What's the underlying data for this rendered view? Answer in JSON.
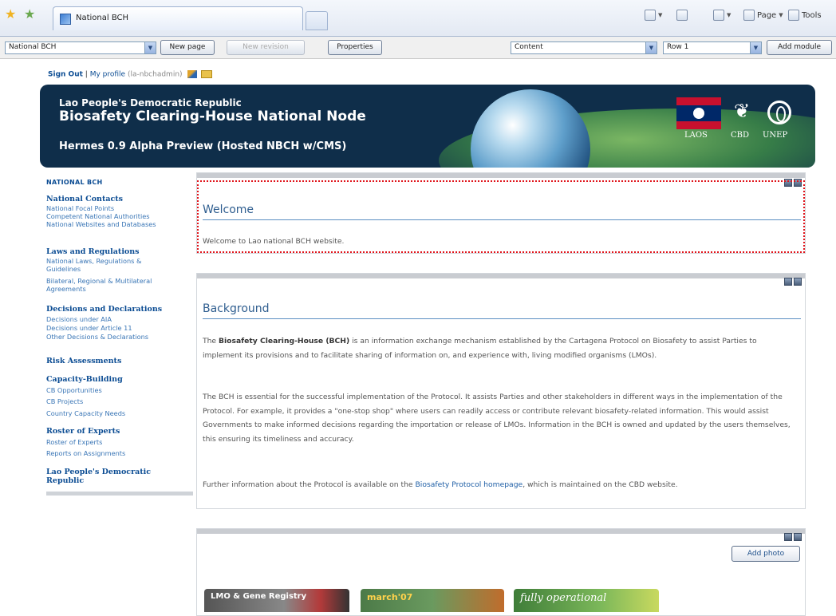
{
  "browser": {
    "tab_title": "National BCH",
    "page_menu": "Page",
    "tools_menu": "Tools"
  },
  "cms_toolbar": {
    "page_select": "National BCH",
    "new_page": "New page",
    "new_revision": "New revision",
    "properties": "Properties",
    "region_select": "Content",
    "row_select": "Row 1",
    "add_module": "Add module"
  },
  "user": {
    "sign_out": "Sign Out",
    "separator": "|",
    "my_profile": "My profile",
    "username": "(la-nbchadmin)"
  },
  "banner": {
    "line1": "Lao People's Democratic Republic",
    "line2": "Biosafety Clearing-House National Node",
    "line3": "Hermes 0.9 Alpha Preview (Hosted NBCH w/CMS)",
    "logo_laos": "LAOS",
    "logo_cbd": "CBD",
    "logo_unep": "UNEP"
  },
  "sidebar": {
    "title": "NATIONAL BCH",
    "sections": [
      {
        "heading": "National Contacts",
        "links": [
          "National Focal Points",
          "Competent National Authorities",
          "National Websites and Databases"
        ]
      },
      {
        "heading": "Laws and Regulations",
        "links": [
          "National Laws, Regulations & Guidelines",
          "Bilateral, Regional & Multilateral Agreements"
        ]
      },
      {
        "heading": "Decisions and Declarations",
        "links": [
          "Decisions under AIA",
          "Decisions under Article 11",
          "Other Decisions & Declarations"
        ]
      },
      {
        "heading": "Risk Assessments",
        "links": []
      },
      {
        "heading": "Capacity-Building",
        "links": [
          "CB Opportunities",
          "CB Projects",
          "Country Capacity Needs"
        ]
      },
      {
        "heading": "Roster of Experts",
        "links": [
          "Roster of Experts",
          "Reports on Assignments"
        ]
      },
      {
        "heading": "Lao People's Democratic Republic",
        "links": []
      }
    ]
  },
  "welcome": {
    "title": "Welcome",
    "text": "Welcome to Lao national BCH website."
  },
  "background": {
    "title": "Background",
    "p1_strong": "Biosafety Clearing-House (BCH)",
    "p1_pre": "The ",
    "p1_post": " is an information exchange mechanism established by the Cartagena Protocol on Biosafety to assist Parties to implement its provisions and to facilitate sharing of information on, and experience with, living modified organisms (LMOs).",
    "p2": "The BCH is essential for the successful implementation of the Protocol. It assists Parties and other stakeholders in different ways in the implementation of the Protocol. For example, it provides a \"one-stop shop\" where users can readily access or contribute relevant biosafety-related information. This would assist Governments to make informed decisions regarding the importation or release of LMOs. Information in the BCH is owned and updated by the users themselves, this ensuring its timeliness and accuracy.",
    "p3_pre": "Further information about the Protocol is available on the ",
    "p3_link": "Biosafety Protocol homepage",
    "p3_post": ", which is maintained on the CBD website."
  },
  "photos": {
    "add_photo": "Add photo",
    "thumb1": "LMO & Gene Registry",
    "thumb2": "march'07",
    "thumb3": "fully operational"
  }
}
